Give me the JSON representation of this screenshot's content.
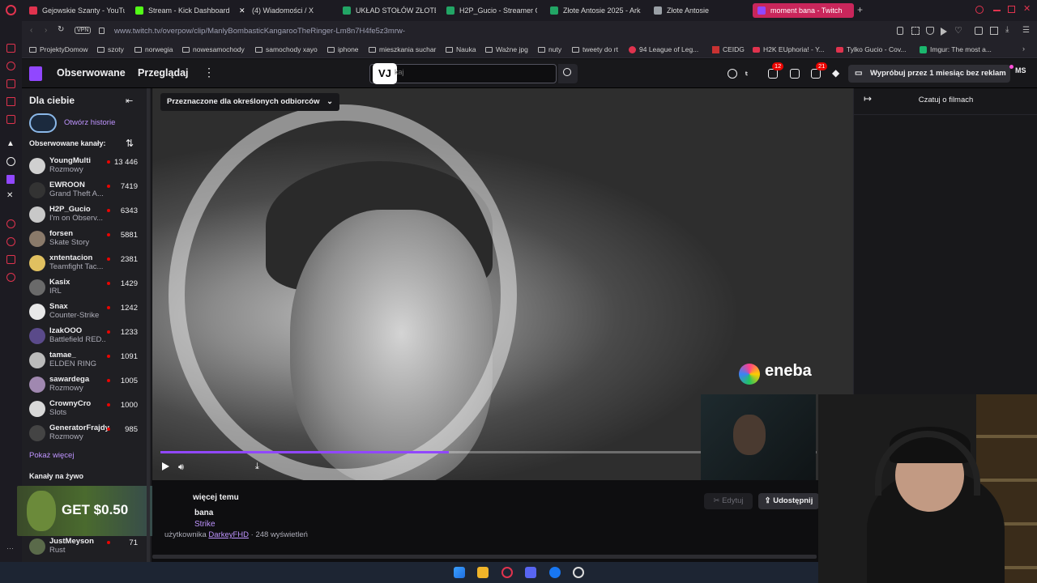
{
  "browser": {
    "tabs": [
      {
        "label": "Gejowskie Szanty - YouTu",
        "color": "#e0334e"
      },
      {
        "label": "Stream - Kick Dashboard",
        "color": "#53fc18"
      },
      {
        "label": "(4) Wiadomości / X",
        "color": "#ffffff"
      },
      {
        "label": "UKŁAD STOŁÓW ZŁOTE",
        "color": "#22a565"
      },
      {
        "label": "H2P_Gucio - Streamer O",
        "color": "#22a565"
      },
      {
        "label": "Złote Antosie 2025 - Ark",
        "color": "#22a565"
      },
      {
        "label": "Złote Antosie",
        "color": "#9aa0a6"
      },
      {
        "label": "moment bana - Twitch",
        "color": "#9147ff"
      }
    ],
    "vpn_label": "VPN",
    "url": "www.twitch.tv/overpow/clip/ManlyBombasticKangarooTheRinger-Lm8n7H4fe5z3mrw-",
    "bookmarks": [
      "ProjektyDomow",
      "szoty",
      "norwegia",
      "nowesamochody",
      "samochody xayo",
      "iphone",
      "mieszkania suchar",
      "Nauka",
      "Ważne jpg",
      "nuty",
      "tweety do rt",
      "94 League of Leg...",
      "CEIDG",
      "H2K EUphoria! - Y...",
      "Tylko Gucio - Cov...",
      "Imgur: The most a..."
    ]
  },
  "twitch_nav": {
    "following": "Obserwowane",
    "browse": "Przeglądaj",
    "search_placeholder": "kaj",
    "vj_logo": "VJ",
    "inbox_badge": "12",
    "notif_badge": "21",
    "promo": "Wypróbuj przez 1 miesiąc bez reklam",
    "user_initials": "MS"
  },
  "sidebar": {
    "title": "Dla ciebie",
    "story_link": "Otwórz historie",
    "followed_header": "Obserwowane kanały:",
    "channels": [
      {
        "name": "YoungMulti",
        "game": "Rozmowy",
        "viewers": "13 446",
        "color": "#d0d0d0"
      },
      {
        "name": "EWROON",
        "game": "Grand Theft A...",
        "viewers": "7419",
        "color": "#333333"
      },
      {
        "name": "H2P_Gucio",
        "game": "I'm on Observ...",
        "viewers": "6343",
        "color": "#c8c8c8"
      },
      {
        "name": "forsen",
        "game": "Skate Story",
        "viewers": "5881",
        "color": "#8a7a6a"
      },
      {
        "name": "xntentacion",
        "game": "Teamfight Tac...",
        "viewers": "2381",
        "color": "#e0c060"
      },
      {
        "name": "Kasix",
        "game": "IRL",
        "viewers": "1429",
        "color": "#6a6a6a"
      },
      {
        "name": "Snax",
        "game": "Counter-Strike",
        "viewers": "1242",
        "color": "#e8e8e8"
      },
      {
        "name": "IzakOOO",
        "game": "Battlefield RED...",
        "viewers": "1233",
        "color": "#5a4a8a"
      },
      {
        "name": "tamae_",
        "game": "ELDEN RING",
        "viewers": "1091",
        "color": "#bbbbbb"
      },
      {
        "name": "sawardega",
        "game": "Rozmowy",
        "viewers": "1005",
        "color": "#a088b0"
      },
      {
        "name": "CrownyCro",
        "game": "Slots",
        "viewers": "1000",
        "color": "#d8d8d8"
      },
      {
        "name": "GeneratorFrajdy",
        "game": "Rozmowy",
        "viewers": "985",
        "color": "#444444"
      }
    ],
    "show_more": "Pokaż więcej",
    "live_header": "Kanały na żywo",
    "ad_text": "GET $0.50",
    "last_channel": {
      "name": "JustMeyson",
      "game": "Rust",
      "viewers": "71"
    }
  },
  "player": {
    "audience_label": "Przeznaczone dla określonych odbiorców",
    "sponsor": "eneba",
    "progress": 0.44
  },
  "clip": {
    "title_partial": "więcej temu",
    "name_partial": "bana",
    "category_partial": "Strike",
    "meta_prefix": "użytkownika",
    "author": "DarkeyFHD",
    "views": "· 248 wyświetleń",
    "edit_label": "Edytuj",
    "share_label": "Udostępnij"
  },
  "chat": {
    "title": "Czatuj o filmach"
  }
}
